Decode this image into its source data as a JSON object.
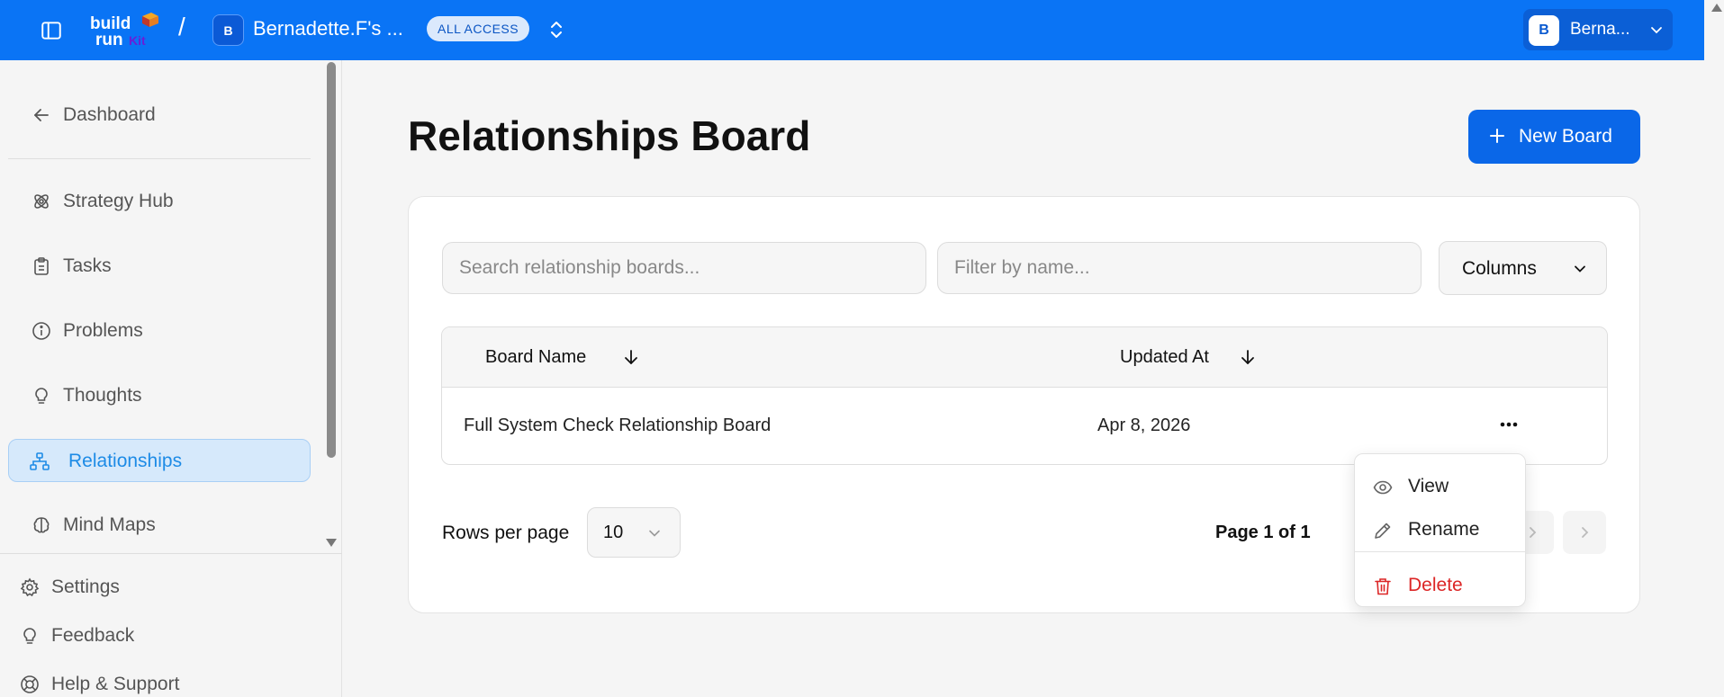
{
  "header": {
    "workspace_initial": "B",
    "workspace_name": "Bernadette.F's ...",
    "access_badge": "ALL ACCESS",
    "user_initial": "B",
    "user_name": "Berna...",
    "logo_text_top": "build",
    "logo_text_bottom": "run",
    "logo_text_accent": "Kit"
  },
  "sidebar": {
    "back_label": "Dashboard",
    "items": [
      {
        "label": "Strategy Hub",
        "icon": "strategy-icon"
      },
      {
        "label": "Tasks",
        "icon": "clipboard-icon"
      },
      {
        "label": "Problems",
        "icon": "info-icon"
      },
      {
        "label": "Thoughts",
        "icon": "lightbulb-icon"
      },
      {
        "label": "Relationships",
        "icon": "network-icon",
        "active": true
      },
      {
        "label": "Mind Maps",
        "icon": "brain-icon"
      }
    ],
    "footer": [
      {
        "label": "Settings",
        "icon": "gear-icon"
      },
      {
        "label": "Feedback",
        "icon": "lightbulb-icon"
      },
      {
        "label": "Help & Support",
        "icon": "lifebuoy-icon"
      }
    ]
  },
  "main": {
    "title": "Relationships Board",
    "new_board_label": "New Board",
    "search_placeholder": "Search relationship boards...",
    "filter_placeholder": "Filter by name...",
    "columns_label": "Columns",
    "table": {
      "headers": [
        "Board Name",
        "Updated At"
      ],
      "rows": [
        {
          "name": "Full System Check Relationship Board",
          "updated": "Apr 8, 2026"
        }
      ]
    },
    "rows_per_page_label": "Rows per page",
    "rows_per_page_value": "10",
    "page_info": "Page 1 of 1"
  },
  "context_menu": {
    "items": [
      "View",
      "Rename",
      "Delete"
    ]
  },
  "colors": {
    "topbar": "#0a74f5",
    "primary": "#0a67e8",
    "active_nav_bg": "#d6e9fb",
    "active_nav_text": "#1d8be6",
    "danger": "#dc2626"
  }
}
